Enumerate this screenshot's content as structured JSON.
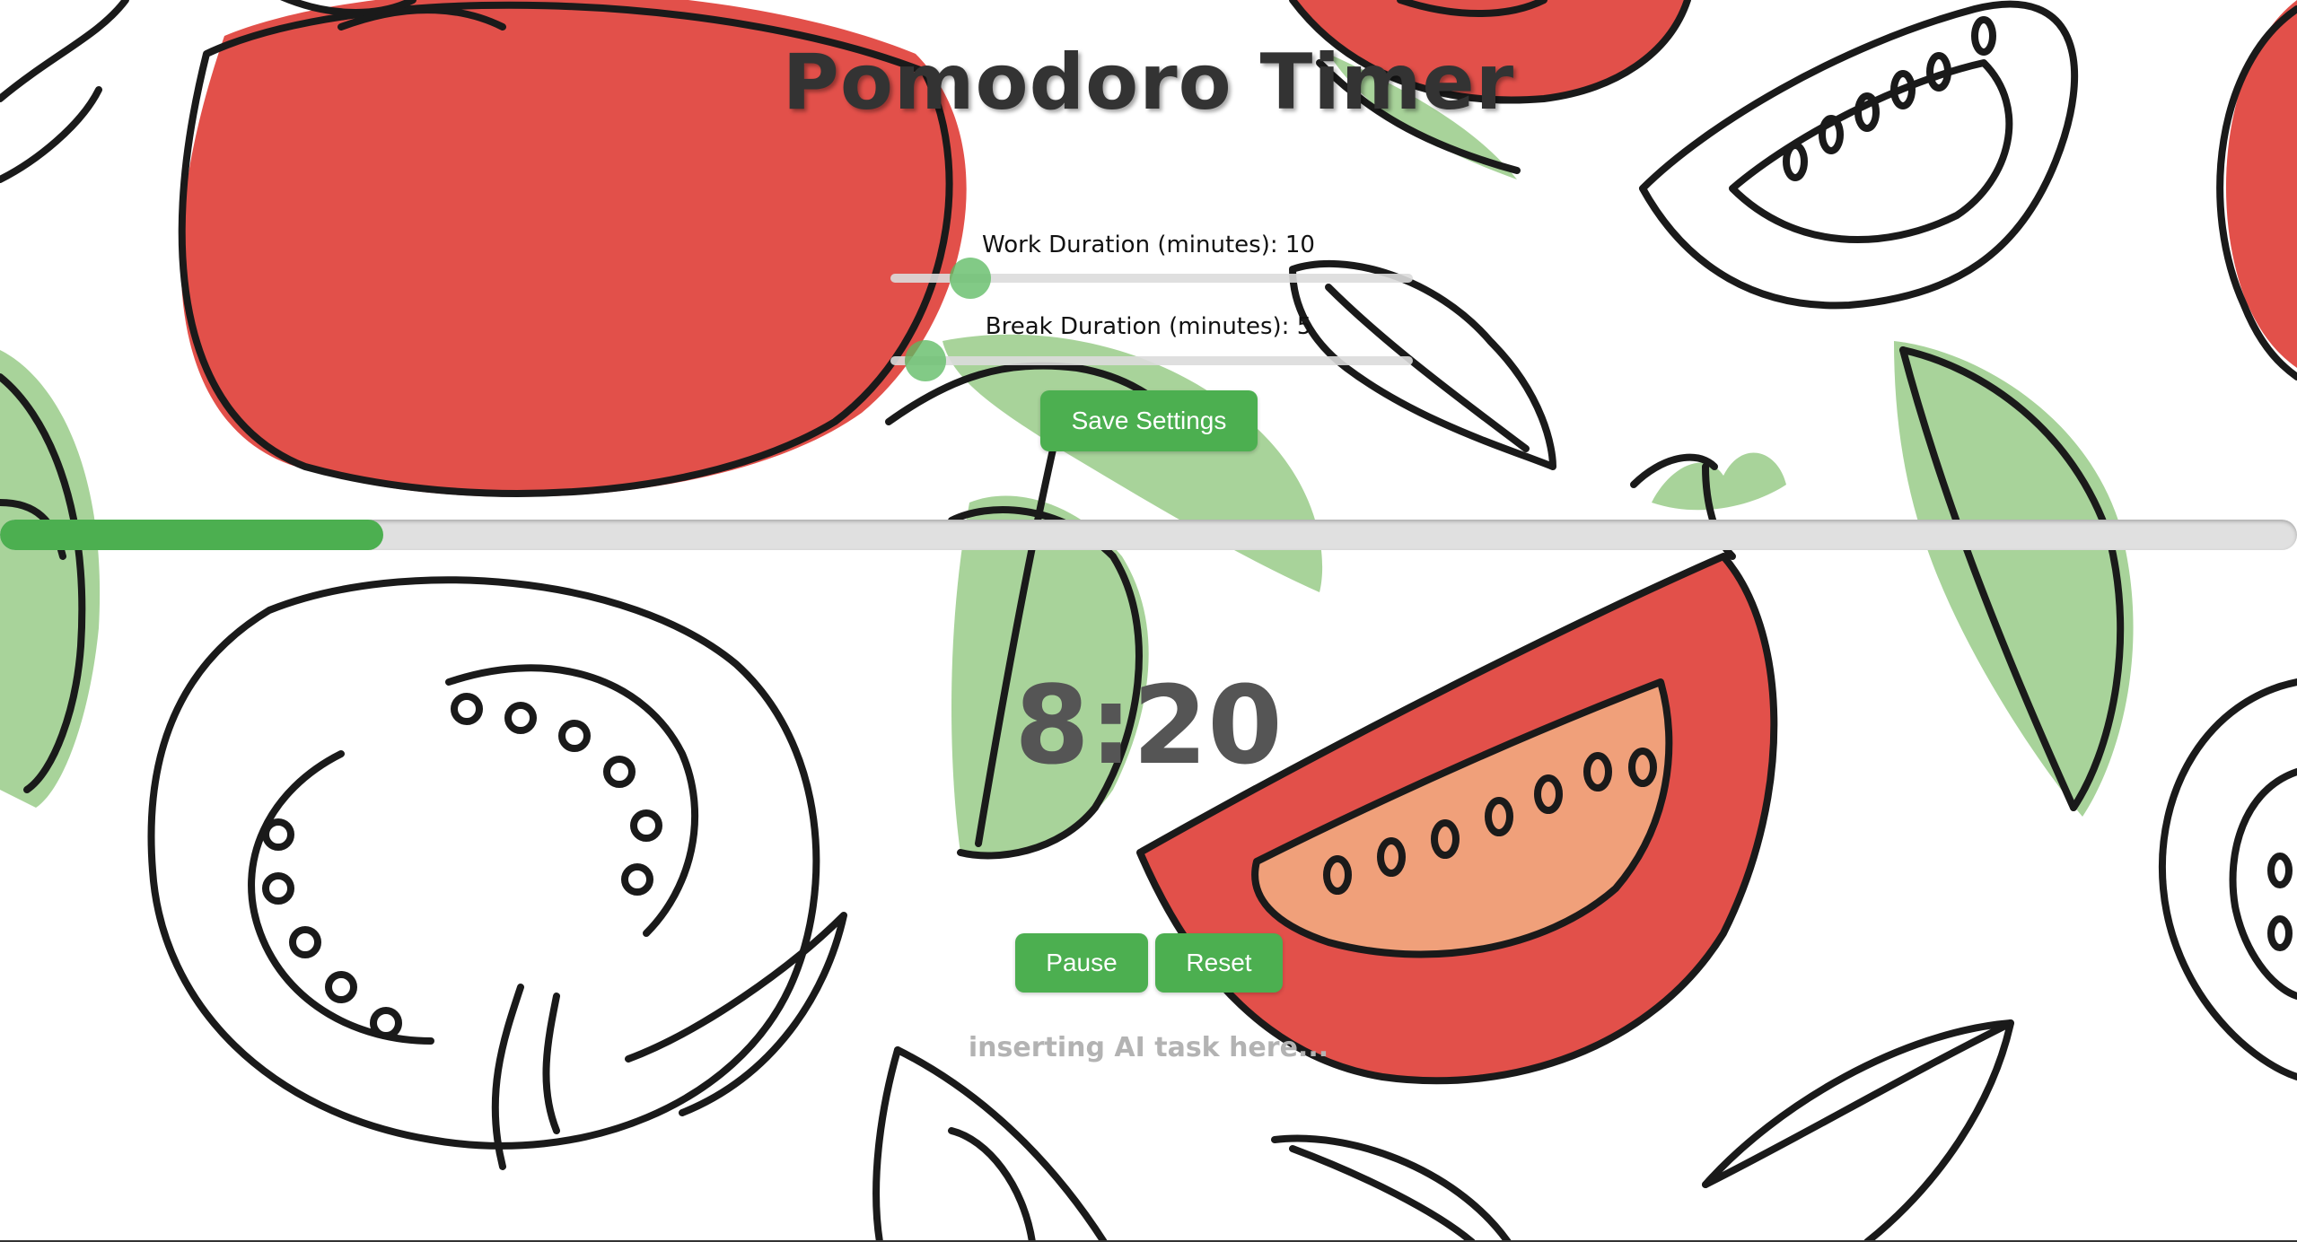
{
  "app": {
    "title": "Pomodoro Timer"
  },
  "settings": {
    "work_label": "Work Duration (minutes): 10",
    "work_minutes": 10,
    "work_min": 1,
    "work_max": 60,
    "break_label": "Break Duration (minutes): 5",
    "break_minutes": 5,
    "break_min": 1,
    "break_max": 60,
    "save_label": "Save Settings"
  },
  "progress": {
    "fraction": 0.167
  },
  "timer": {
    "display": "8:20"
  },
  "controls": {
    "pause_label": "Pause",
    "reset_label": "Reset"
  },
  "ai_task": {
    "text": "inserting AI task here..."
  },
  "colors": {
    "accent": "#4caf50",
    "tomato_red": "#e2504a",
    "leaf_green": "#a8d39a",
    "tomato_flesh": "#f0a07a",
    "timer_text": "#555555",
    "title_text": "#333333"
  }
}
